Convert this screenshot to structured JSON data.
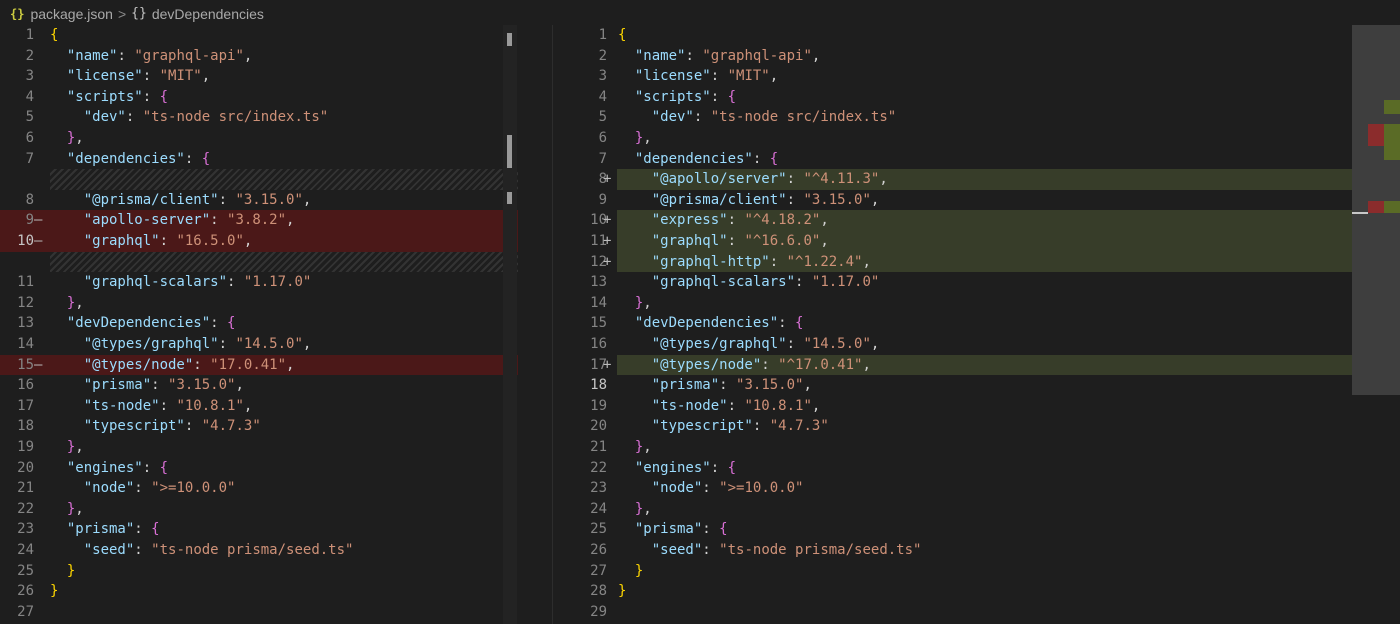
{
  "breadcrumb": {
    "file_icon": "{}",
    "file": "package.json",
    "sep": ">",
    "symbol_icon": "{}",
    "symbol": "devDependencies"
  },
  "colors": {
    "deleted_line": "#4b1818",
    "added_line": "#373d29",
    "deleted_char": "#7a2a2a",
    "added_char": "#5a6b26"
  },
  "left": [
    {
      "n": "1",
      "code": "{"
    },
    {
      "n": "2",
      "code": "  \"name\": \"graphql-api\","
    },
    {
      "n": "3",
      "code": "  \"license\": \"MIT\","
    },
    {
      "n": "4",
      "code": "  \"scripts\": {"
    },
    {
      "n": "5",
      "code": "    \"dev\": \"ts-node src/index.ts\""
    },
    {
      "n": "6",
      "code": "  },"
    },
    {
      "n": "7",
      "code": "  \"dependencies\": {"
    },
    {
      "n": "",
      "code": "",
      "hatch": true
    },
    {
      "n": "8",
      "code": "    \"@prisma/client\": \"3.15.0\","
    },
    {
      "n": "9",
      "code": "    \"apollo-server\": \"3.8.2\",",
      "type": "del",
      "marker": "—"
    },
    {
      "n": "10",
      "code": "    \"graphql\": \"16.5.0\",",
      "type": "del",
      "marker": "—",
      "active": true
    },
    {
      "n": "",
      "code": "",
      "hatch": true
    },
    {
      "n": "11",
      "code": "    \"graphql-scalars\": \"1.17.0\""
    },
    {
      "n": "12",
      "code": "  },"
    },
    {
      "n": "13",
      "code": "  \"devDependencies\": {"
    },
    {
      "n": "14",
      "code": "    \"@types/graphql\": \"14.5.0\","
    },
    {
      "n": "15",
      "code": "    \"@types/node\": \"17.0.41\",",
      "type": "del",
      "marker": "—"
    },
    {
      "n": "16",
      "code": "    \"prisma\": \"3.15.0\","
    },
    {
      "n": "17",
      "code": "    \"ts-node\": \"10.8.1\","
    },
    {
      "n": "18",
      "code": "    \"typescript\": \"4.7.3\""
    },
    {
      "n": "19",
      "code": "  },"
    },
    {
      "n": "20",
      "code": "  \"engines\": {"
    },
    {
      "n": "21",
      "code": "    \"node\": \">=10.0.0\""
    },
    {
      "n": "22",
      "code": "  },"
    },
    {
      "n": "23",
      "code": "  \"prisma\": {"
    },
    {
      "n": "24",
      "code": "    \"seed\": \"ts-node prisma/seed.ts\""
    },
    {
      "n": "25",
      "code": "  }"
    },
    {
      "n": "26",
      "code": "}"
    },
    {
      "n": "27",
      "code": ""
    }
  ],
  "right": [
    {
      "n": "1",
      "code": "{"
    },
    {
      "n": "2",
      "code": "  \"name\": \"graphql-api\","
    },
    {
      "n": "3",
      "code": "  \"license\": \"MIT\","
    },
    {
      "n": "4",
      "code": "  \"scripts\": {"
    },
    {
      "n": "5",
      "code": "    \"dev\": \"ts-node src/index.ts\""
    },
    {
      "n": "6",
      "code": "  },"
    },
    {
      "n": "7",
      "code": "  \"dependencies\": {"
    },
    {
      "n": "8",
      "code": "    \"@apollo/server\": \"^4.11.3\",",
      "type": "add",
      "marker": "+"
    },
    {
      "n": "9",
      "code": "    \"@prisma/client\": \"3.15.0\","
    },
    {
      "n": "10",
      "code": "    \"express\": \"^4.18.2\",",
      "type": "add",
      "marker": "+"
    },
    {
      "n": "11",
      "code": "    \"graphql\": \"^16.6.0\",",
      "type": "add",
      "marker": "+"
    },
    {
      "n": "12",
      "code": "    \"graphql-http\": \"^1.22.4\",",
      "type": "add",
      "marker": "+"
    },
    {
      "n": "13",
      "code": "    \"graphql-scalars\": \"1.17.0\""
    },
    {
      "n": "14",
      "code": "  },"
    },
    {
      "n": "15",
      "code": "  \"devDependencies\": {"
    },
    {
      "n": "16",
      "code": "    \"@types/graphql\": \"14.5.0\","
    },
    {
      "n": "17",
      "code": "    \"@types/node\": \"^17.0.41\",",
      "type": "add",
      "marker": "+"
    },
    {
      "n": "18",
      "code": "    \"prisma\": \"3.15.0\",",
      "active": true
    },
    {
      "n": "19",
      "code": "    \"ts-node\": \"10.8.1\","
    },
    {
      "n": "20",
      "code": "    \"typescript\": \"4.7.3\""
    },
    {
      "n": "21",
      "code": "  },"
    },
    {
      "n": "22",
      "code": "  \"engines\": {"
    },
    {
      "n": "23",
      "code": "    \"node\": \">=10.0.0\""
    },
    {
      "n": "24",
      "code": "  },"
    },
    {
      "n": "25",
      "code": "  \"prisma\": {"
    },
    {
      "n": "26",
      "code": "    \"seed\": \"ts-node prisma/seed.ts\""
    },
    {
      "n": "27",
      "code": "  }"
    },
    {
      "n": "28",
      "code": "}"
    },
    {
      "n": "29",
      "code": ""
    }
  ]
}
